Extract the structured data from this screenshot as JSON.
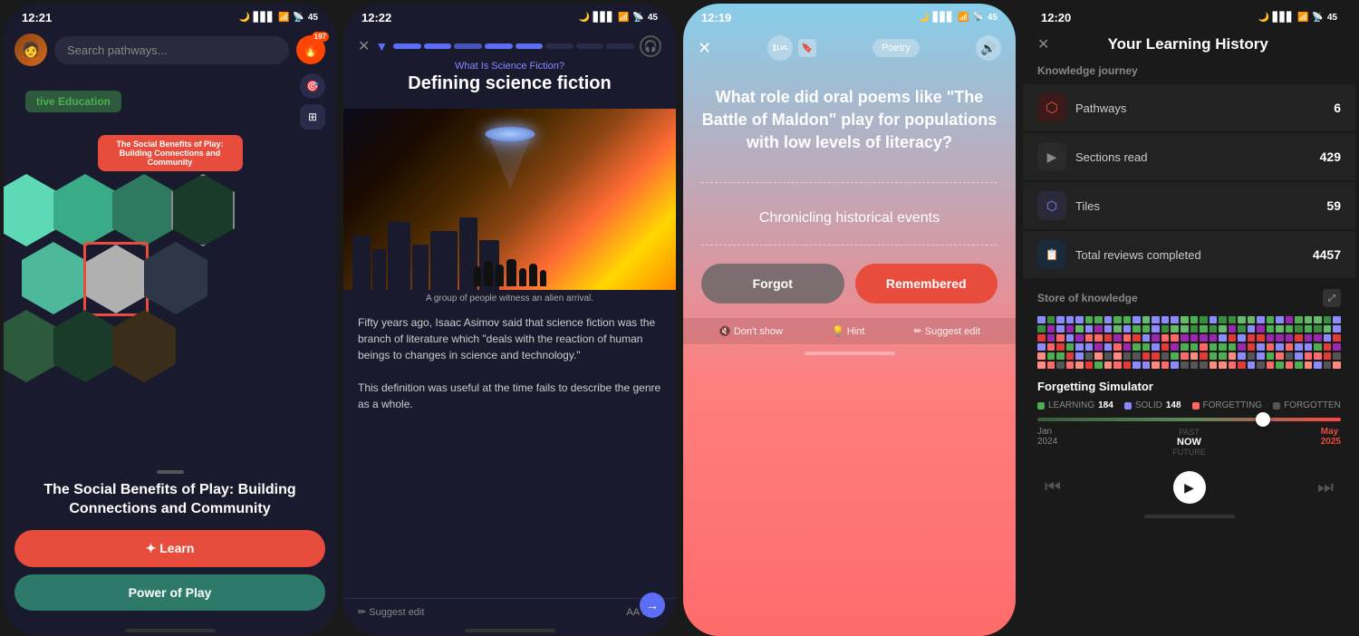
{
  "phone1": {
    "status": {
      "time": "12:21",
      "battery": "45",
      "moon": true
    },
    "search": {
      "placeholder": "Search pathways..."
    },
    "fire": {
      "count": "197"
    },
    "category": "tive Education",
    "selected_card": "The Social Benefits of Play: Building Connections and Community",
    "title": "The Social Benefits of Play: Building Connections and Community",
    "learn_btn": "✦ Learn",
    "power_btn": "Power of Play"
  },
  "phone2": {
    "status": {
      "time": "12:22",
      "battery": "45"
    },
    "subtitle": "What Is Science Fiction?",
    "title": "Defining science fiction",
    "image_caption": "A group of people witness an alien arrival.",
    "body1": "Fifty years ago, Isaac Asimov said that science fiction was the branch of literature which \"deals with the reaction of human beings to changes in science and technology.\"",
    "body2": "This definition was useful at the time fails to describe the genre as a whole.",
    "suggest_edit": "✏ Suggest edit",
    "aa_size": "AA Size"
  },
  "phone3": {
    "status": {
      "time": "12:19",
      "battery": "45"
    },
    "level": "1",
    "category": "Poetry",
    "question": "What role did oral poems like \"The Battle of Maldon\" play for populations with low levels of literacy?",
    "answer": "Chronicling historical events",
    "forgot_btn": "Forgot",
    "remembered_btn": "Remembered",
    "dont_show": "🔇 Don't show",
    "hint": "💡 Hint",
    "suggest_edit": "✏ Suggest edit"
  },
  "phone4": {
    "status": {
      "time": "12:20",
      "battery": "45"
    },
    "title": "Your Learning History",
    "knowledge_journey": "Knowledge journey",
    "stats": [
      {
        "icon": "🔴",
        "label": "Pathways",
        "value": "6",
        "icon_class": "stat-icon-red"
      },
      {
        "icon": "▶",
        "label": "Sections read",
        "value": "429",
        "icon_class": "stat-icon-gray"
      },
      {
        "icon": "⬡",
        "label": "Tiles",
        "value": "59",
        "icon_class": "stat-icon-hex"
      },
      {
        "icon": "📋",
        "label": "Total reviews completed",
        "value": "4457",
        "icon_class": "stat-icon-blue"
      }
    ],
    "store_of_knowledge": "Store of knowledge",
    "forgetting_simulator": "Forgetting Simulator",
    "legend": [
      {
        "label": "LEARNING",
        "value": "184",
        "color": "#4CAF50"
      },
      {
        "label": "SOLID",
        "value": "148",
        "color": "#8B8BFF"
      },
      {
        "label": "FORGETTING",
        "value": "",
        "color": "#FF6666"
      },
      {
        "label": "FORGOTTEN",
        "value": "",
        "color": "#888"
      }
    ],
    "timeline_start": "Jan\n2024",
    "timeline_now": "NOW",
    "timeline_end": "May\n2025",
    "timeline_past": "PAST",
    "timeline_future": "FUTURE",
    "timeline_thumb_pos": "72"
  }
}
